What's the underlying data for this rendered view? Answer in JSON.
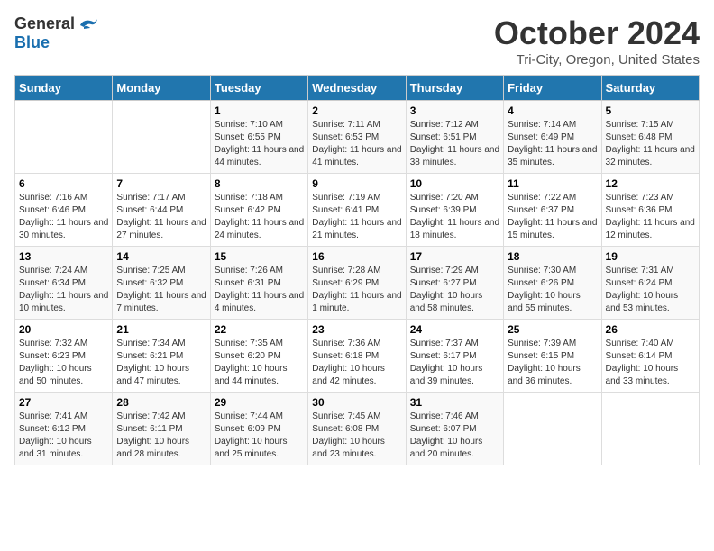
{
  "header": {
    "logo_general": "General",
    "logo_blue": "Blue",
    "month_title": "October 2024",
    "location": "Tri-City, Oregon, United States"
  },
  "days_of_week": [
    "Sunday",
    "Monday",
    "Tuesday",
    "Wednesday",
    "Thursday",
    "Friday",
    "Saturday"
  ],
  "weeks": [
    [
      {
        "day": "",
        "sunrise": "",
        "sunset": "",
        "daylight": ""
      },
      {
        "day": "",
        "sunrise": "",
        "sunset": "",
        "daylight": ""
      },
      {
        "day": "1",
        "sunrise": "Sunrise: 7:10 AM",
        "sunset": "Sunset: 6:55 PM",
        "daylight": "Daylight: 11 hours and 44 minutes."
      },
      {
        "day": "2",
        "sunrise": "Sunrise: 7:11 AM",
        "sunset": "Sunset: 6:53 PM",
        "daylight": "Daylight: 11 hours and 41 minutes."
      },
      {
        "day": "3",
        "sunrise": "Sunrise: 7:12 AM",
        "sunset": "Sunset: 6:51 PM",
        "daylight": "Daylight: 11 hours and 38 minutes."
      },
      {
        "day": "4",
        "sunrise": "Sunrise: 7:14 AM",
        "sunset": "Sunset: 6:49 PM",
        "daylight": "Daylight: 11 hours and 35 minutes."
      },
      {
        "day": "5",
        "sunrise": "Sunrise: 7:15 AM",
        "sunset": "Sunset: 6:48 PM",
        "daylight": "Daylight: 11 hours and 32 minutes."
      }
    ],
    [
      {
        "day": "6",
        "sunrise": "Sunrise: 7:16 AM",
        "sunset": "Sunset: 6:46 PM",
        "daylight": "Daylight: 11 hours and 30 minutes."
      },
      {
        "day": "7",
        "sunrise": "Sunrise: 7:17 AM",
        "sunset": "Sunset: 6:44 PM",
        "daylight": "Daylight: 11 hours and 27 minutes."
      },
      {
        "day": "8",
        "sunrise": "Sunrise: 7:18 AM",
        "sunset": "Sunset: 6:42 PM",
        "daylight": "Daylight: 11 hours and 24 minutes."
      },
      {
        "day": "9",
        "sunrise": "Sunrise: 7:19 AM",
        "sunset": "Sunset: 6:41 PM",
        "daylight": "Daylight: 11 hours and 21 minutes."
      },
      {
        "day": "10",
        "sunrise": "Sunrise: 7:20 AM",
        "sunset": "Sunset: 6:39 PM",
        "daylight": "Daylight: 11 hours and 18 minutes."
      },
      {
        "day": "11",
        "sunrise": "Sunrise: 7:22 AM",
        "sunset": "Sunset: 6:37 PM",
        "daylight": "Daylight: 11 hours and 15 minutes."
      },
      {
        "day": "12",
        "sunrise": "Sunrise: 7:23 AM",
        "sunset": "Sunset: 6:36 PM",
        "daylight": "Daylight: 11 hours and 12 minutes."
      }
    ],
    [
      {
        "day": "13",
        "sunrise": "Sunrise: 7:24 AM",
        "sunset": "Sunset: 6:34 PM",
        "daylight": "Daylight: 11 hours and 10 minutes."
      },
      {
        "day": "14",
        "sunrise": "Sunrise: 7:25 AM",
        "sunset": "Sunset: 6:32 PM",
        "daylight": "Daylight: 11 hours and 7 minutes."
      },
      {
        "day": "15",
        "sunrise": "Sunrise: 7:26 AM",
        "sunset": "Sunset: 6:31 PM",
        "daylight": "Daylight: 11 hours and 4 minutes."
      },
      {
        "day": "16",
        "sunrise": "Sunrise: 7:28 AM",
        "sunset": "Sunset: 6:29 PM",
        "daylight": "Daylight: 11 hours and 1 minute."
      },
      {
        "day": "17",
        "sunrise": "Sunrise: 7:29 AM",
        "sunset": "Sunset: 6:27 PM",
        "daylight": "Daylight: 10 hours and 58 minutes."
      },
      {
        "day": "18",
        "sunrise": "Sunrise: 7:30 AM",
        "sunset": "Sunset: 6:26 PM",
        "daylight": "Daylight: 10 hours and 55 minutes."
      },
      {
        "day": "19",
        "sunrise": "Sunrise: 7:31 AM",
        "sunset": "Sunset: 6:24 PM",
        "daylight": "Daylight: 10 hours and 53 minutes."
      }
    ],
    [
      {
        "day": "20",
        "sunrise": "Sunrise: 7:32 AM",
        "sunset": "Sunset: 6:23 PM",
        "daylight": "Daylight: 10 hours and 50 minutes."
      },
      {
        "day": "21",
        "sunrise": "Sunrise: 7:34 AM",
        "sunset": "Sunset: 6:21 PM",
        "daylight": "Daylight: 10 hours and 47 minutes."
      },
      {
        "day": "22",
        "sunrise": "Sunrise: 7:35 AM",
        "sunset": "Sunset: 6:20 PM",
        "daylight": "Daylight: 10 hours and 44 minutes."
      },
      {
        "day": "23",
        "sunrise": "Sunrise: 7:36 AM",
        "sunset": "Sunset: 6:18 PM",
        "daylight": "Daylight: 10 hours and 42 minutes."
      },
      {
        "day": "24",
        "sunrise": "Sunrise: 7:37 AM",
        "sunset": "Sunset: 6:17 PM",
        "daylight": "Daylight: 10 hours and 39 minutes."
      },
      {
        "day": "25",
        "sunrise": "Sunrise: 7:39 AM",
        "sunset": "Sunset: 6:15 PM",
        "daylight": "Daylight: 10 hours and 36 minutes."
      },
      {
        "day": "26",
        "sunrise": "Sunrise: 7:40 AM",
        "sunset": "Sunset: 6:14 PM",
        "daylight": "Daylight: 10 hours and 33 minutes."
      }
    ],
    [
      {
        "day": "27",
        "sunrise": "Sunrise: 7:41 AM",
        "sunset": "Sunset: 6:12 PM",
        "daylight": "Daylight: 10 hours and 31 minutes."
      },
      {
        "day": "28",
        "sunrise": "Sunrise: 7:42 AM",
        "sunset": "Sunset: 6:11 PM",
        "daylight": "Daylight: 10 hours and 28 minutes."
      },
      {
        "day": "29",
        "sunrise": "Sunrise: 7:44 AM",
        "sunset": "Sunset: 6:09 PM",
        "daylight": "Daylight: 10 hours and 25 minutes."
      },
      {
        "day": "30",
        "sunrise": "Sunrise: 7:45 AM",
        "sunset": "Sunset: 6:08 PM",
        "daylight": "Daylight: 10 hours and 23 minutes."
      },
      {
        "day": "31",
        "sunrise": "Sunrise: 7:46 AM",
        "sunset": "Sunset: 6:07 PM",
        "daylight": "Daylight: 10 hours and 20 minutes."
      },
      {
        "day": "",
        "sunrise": "",
        "sunset": "",
        "daylight": ""
      },
      {
        "day": "",
        "sunrise": "",
        "sunset": "",
        "daylight": ""
      }
    ]
  ]
}
